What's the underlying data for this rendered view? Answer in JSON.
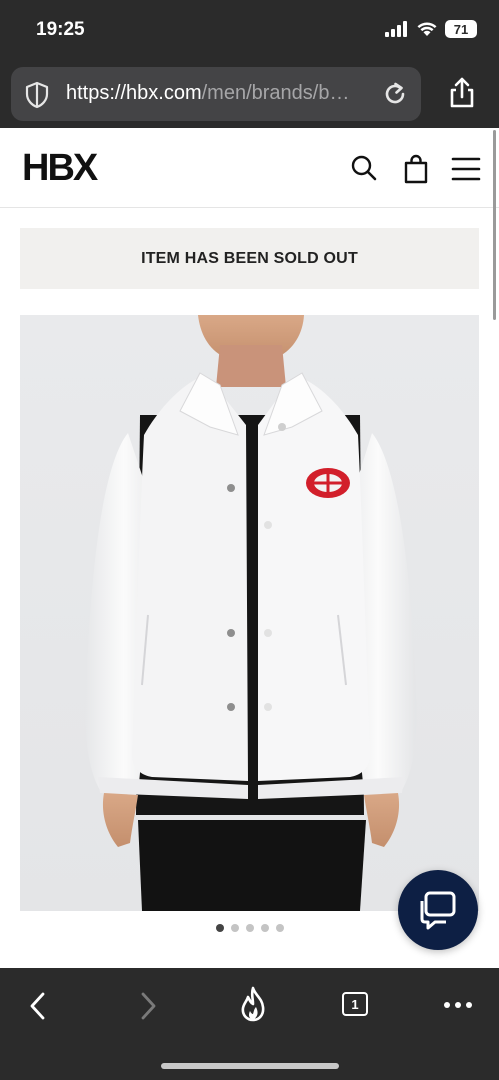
{
  "status_bar": {
    "time": "19:25",
    "battery": "71"
  },
  "browser": {
    "url_host": "https://hbx.com",
    "url_path": "/men/brands/b…"
  },
  "site": {
    "logo": "HBX",
    "sold_out_message": "ITEM HAS BEEN SOLD OUT"
  },
  "gallery": {
    "total_images": 5,
    "active_index": 0
  },
  "bottom_bar": {
    "tab_count": "1"
  },
  "colors": {
    "chrome": "#2b2b2b",
    "chat_button": "#0d1f44",
    "banner": "#f1f0ee",
    "badge_red": "#d21f2b"
  },
  "icons": [
    "signal-icon",
    "wifi-icon",
    "shield-icon",
    "reload-icon",
    "share-icon",
    "search-icon",
    "shopping-bag-icon",
    "hamburger-menu-icon",
    "chat-icon",
    "back-icon",
    "forward-icon",
    "flame-icon",
    "more-icon"
  ]
}
